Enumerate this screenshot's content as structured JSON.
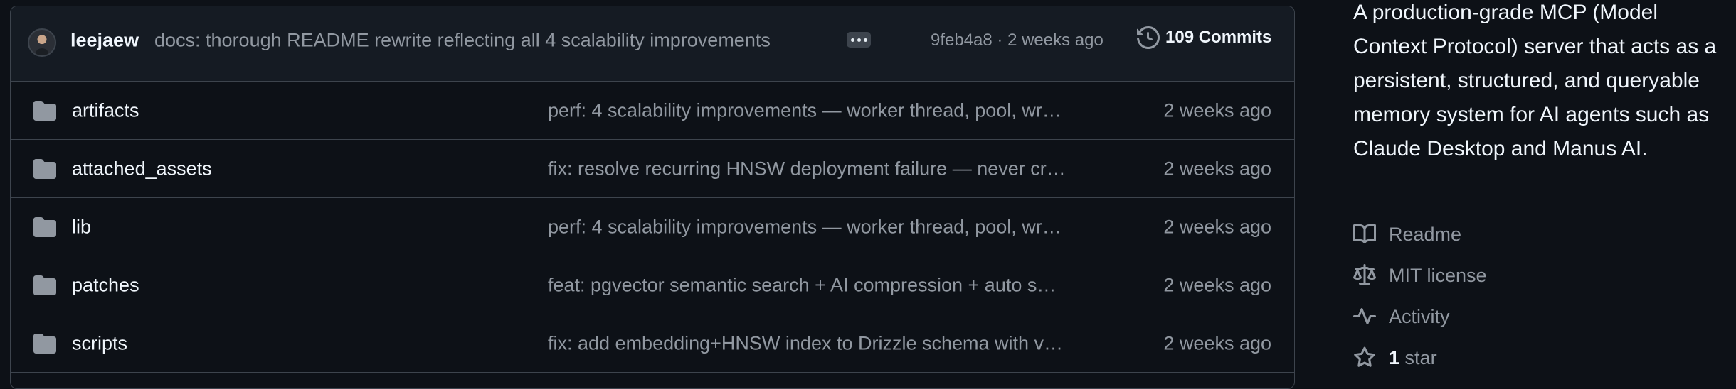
{
  "latest_commit": {
    "author": "leejaew",
    "message": "docs: thorough README rewrite reflecting all 4 scalability improvements",
    "meta": "9feb4a8 · 2 weeks ago",
    "commits_label": "109 Commits"
  },
  "files": [
    {
      "name": "artifacts",
      "commit": "perf: 4 scalability improvements — worker thread, pool, wr…",
      "time": "2 weeks ago"
    },
    {
      "name": "attached_assets",
      "commit": "fix: resolve recurring HNSW deployment failure — never cr…",
      "time": "2 weeks ago"
    },
    {
      "name": "lib",
      "commit": "perf: 4 scalability improvements — worker thread, pool, wr…",
      "time": "2 weeks ago"
    },
    {
      "name": "patches",
      "commit": "feat: pgvector semantic search + AI compression + auto s…",
      "time": "2 weeks ago"
    },
    {
      "name": "scripts",
      "commit": "fix: add embedding+HNSW index to Drizzle schema with v…",
      "time": "2 weeks ago"
    }
  ],
  "about": {
    "description": "A production-grade MCP (Model Context Protocol) server that acts as a persistent, structured, and queryable memory system for AI agents such as Claude Desktop and Manus AI.",
    "links": {
      "readme": "Readme",
      "license": "MIT license",
      "activity": "Activity",
      "stars_count": "1",
      "stars_label": "star"
    }
  },
  "icons": {
    "folder": "folder-icon",
    "history": "history-icon",
    "readme": "book-icon",
    "license": "scale-icon",
    "activity": "pulse-icon",
    "star": "star-icon",
    "more": "kebab-horizontal-icon"
  },
  "colors": {
    "background": "#0d1117",
    "header_bg": "#151b23",
    "border": "#3d444d",
    "text_primary": "#f0f6fc",
    "text_muted": "#9198a1",
    "folder": "#9198a1"
  }
}
